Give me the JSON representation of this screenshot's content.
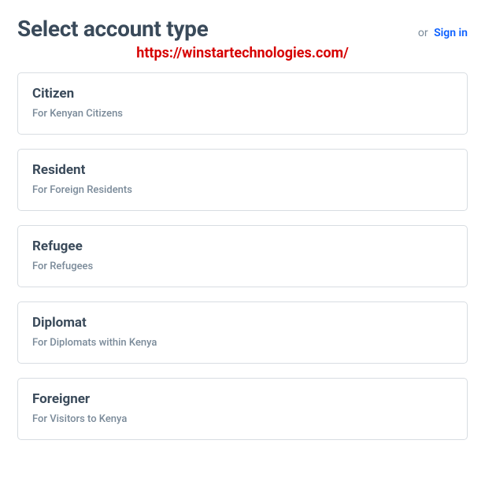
{
  "header": {
    "title": "Select account type",
    "or_text": "or",
    "signin_label": "Sign in"
  },
  "overlay_url": "https://winstartechnologies.com/",
  "options": [
    {
      "title": "Citizen",
      "desc": "For Kenyan Citizens"
    },
    {
      "title": "Resident",
      "desc": "For Foreign Residents"
    },
    {
      "title": "Refugee",
      "desc": "For Refugees"
    },
    {
      "title": "Diplomat",
      "desc": "For Diplomats within Kenya"
    },
    {
      "title": "Foreigner",
      "desc": "For Visitors to Kenya"
    }
  ]
}
